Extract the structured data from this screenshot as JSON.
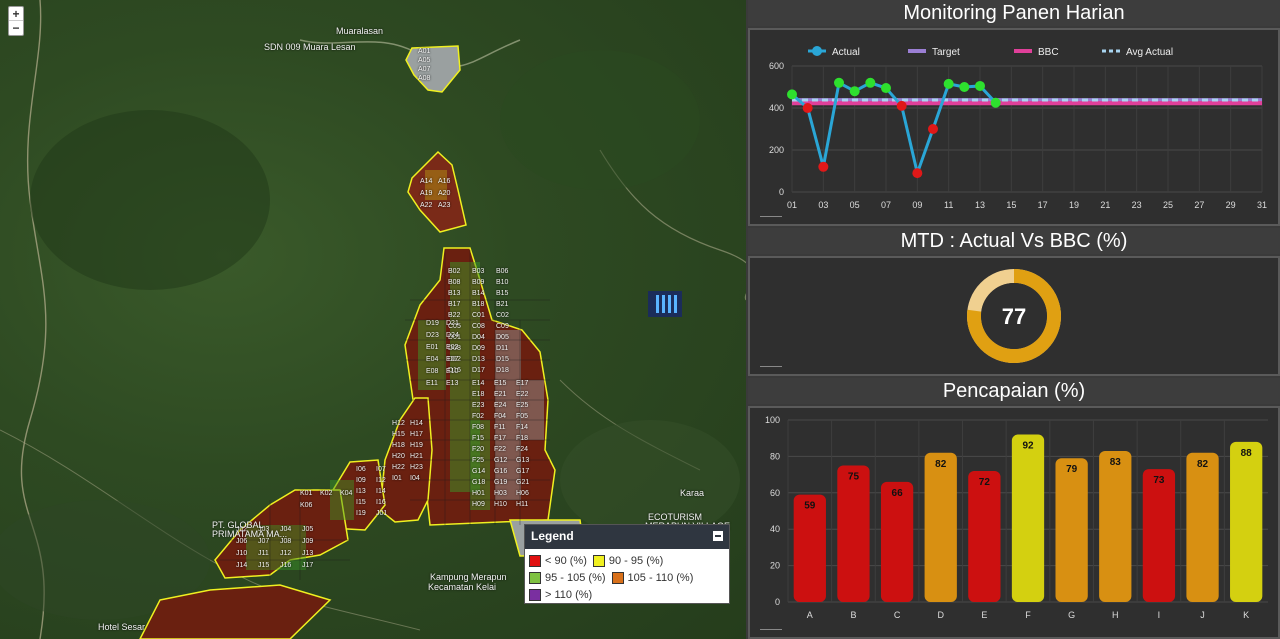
{
  "map": {
    "zoom_in": "+",
    "zoom_out": "−",
    "places": {
      "muaralasan": "Muaralasan",
      "sdn": "SDN 009 Muara Lesan",
      "karaa": "Karaa",
      "ecotourism_1": "ECOTURISM",
      "ecotourism_2": "MERAPUN VILLAGE",
      "global_1": "PT. GLOBAL",
      "global_2": "PRIMATAMA MA...",
      "kampung_1": "Kampung Merapun",
      "kampung_2": "Kecamatan Kelai",
      "hotel": "Hotel Sesar"
    },
    "block_labels": [
      "A01",
      "A05",
      "A07",
      "A08",
      "A14",
      "A16",
      "A19",
      "A20",
      "A22",
      "A23",
      "B02",
      "B03",
      "B06",
      "B08",
      "B09",
      "B10",
      "B13",
      "B14",
      "B15",
      "B17",
      "B18",
      "B21",
      "B22",
      "C01",
      "C02",
      "C05",
      "C08",
      "C09",
      "D01",
      "D04",
      "D05",
      "D08",
      "D09",
      "D11",
      "D12",
      "D13",
      "D15",
      "D16",
      "D17",
      "D18",
      "D19",
      "D21",
      "D23",
      "D24",
      "E01",
      "E02",
      "E04",
      "E07",
      "E08",
      "E10",
      "E11",
      "E13",
      "E14",
      "E15",
      "E17",
      "E18",
      "E21",
      "E22",
      "E23",
      "E24",
      "E25",
      "F02",
      "F04",
      "F05",
      "F08",
      "F11",
      "F14",
      "F15",
      "F17",
      "F18",
      "F20",
      "F22",
      "F24",
      "F25",
      "G12",
      "G13",
      "G14",
      "G16",
      "G17",
      "G18",
      "G19",
      "G21",
      "H01",
      "H03",
      "H06",
      "H09",
      "H10",
      "H11",
      "H12",
      "H14",
      "H15",
      "H17",
      "H18",
      "H19",
      "H20",
      "H21",
      "H22",
      "H23",
      "I01",
      "I04",
      "I06",
      "I07",
      "I09",
      "I12",
      "I13",
      "I14",
      "I15",
      "I16",
      "I19",
      "J01",
      "J02",
      "J03",
      "J04",
      "J05",
      "J06",
      "J07",
      "J08",
      "J09",
      "J10",
      "J11",
      "J12",
      "J13",
      "J14",
      "J15",
      "J16",
      "J17",
      "K01",
      "K02",
      "K04",
      "K06"
    ],
    "legend": {
      "title": "Legend",
      "items": [
        {
          "label": "< 90 (%)",
          "color": "#e01010"
        },
        {
          "label": "90 - 95 (%)",
          "color": "#f0f020"
        },
        {
          "label": "95 - 105 (%)",
          "color": "#7fc241"
        },
        {
          "label": "105 - 110 (%)",
          "color": "#d8701a"
        },
        {
          "label": "> 110 (%)",
          "color": "#7a2fa0"
        }
      ]
    }
  },
  "panel1": {
    "title": "Monitoring Panen Harian",
    "chart_data": {
      "type": "line",
      "ylim": [
        0,
        600
      ],
      "yticks": [
        0,
        200,
        400,
        600
      ],
      "xlabels": [
        "01",
        "03",
        "05",
        "07",
        "09",
        "11",
        "13",
        "15",
        "17",
        "19",
        "21",
        "23",
        "25",
        "27",
        "29",
        "31"
      ],
      "days": [
        1,
        2,
        3,
        4,
        5,
        6,
        7,
        8,
        9,
        10,
        11,
        12,
        13,
        14,
        15,
        16,
        17,
        18,
        19,
        20,
        21,
        22,
        23,
        24,
        25,
        26,
        27,
        28,
        29,
        30,
        31
      ],
      "series": [
        {
          "name": "Actual",
          "color": "#2aa6d6",
          "values": [
            465,
            400,
            120,
            520,
            480,
            520,
            495,
            410,
            90,
            300,
            515,
            500,
            505,
            425
          ]
        },
        {
          "name": "Target",
          "color": "#9b7fd4",
          "values": [
            440,
            440,
            440,
            440,
            440,
            440,
            440,
            440,
            440,
            440,
            440,
            440,
            440,
            440,
            440,
            440,
            440,
            440,
            440,
            440,
            440,
            440,
            440,
            440,
            440,
            440,
            440,
            440,
            440,
            440,
            440
          ]
        },
        {
          "name": "BBC",
          "color": "#e0409a",
          "values": [
            425,
            425,
            425,
            425,
            425,
            425,
            425,
            425,
            425,
            425,
            425,
            425,
            425,
            425,
            425,
            425,
            425,
            425,
            425,
            425,
            425,
            425,
            425,
            425,
            425,
            425,
            425,
            425,
            425,
            425,
            425
          ]
        },
        {
          "name": "Avg Actual",
          "color": "#a8d4f0",
          "values": [
            438,
            438,
            438,
            438,
            438,
            438,
            438,
            438,
            438,
            438,
            438,
            438,
            438,
            438,
            438,
            438,
            438,
            438,
            438,
            438,
            438,
            438,
            438,
            438,
            438,
            438,
            438,
            438,
            438,
            438,
            438
          ]
        }
      ]
    }
  },
  "panel2": {
    "title": "MTD : Actual Vs BBC (%)",
    "chart_data": {
      "type": "pie",
      "value": 77,
      "label": "77",
      "fill_color": "#e0a012",
      "rest_color": "#f0d090"
    }
  },
  "panel3": {
    "title": "Pencapaian (%)",
    "chart_data": {
      "type": "bar",
      "ylim": [
        0,
        100
      ],
      "yticks": [
        0,
        20,
        40,
        60,
        80,
        100
      ],
      "categories": [
        "A",
        "B",
        "C",
        "D",
        "E",
        "F",
        "G",
        "H",
        "I",
        "J",
        "K"
      ],
      "values": [
        59,
        75,
        66,
        82,
        72,
        92,
        79,
        83,
        73,
        82,
        88
      ],
      "colors": [
        "#cc1010",
        "#cc1010",
        "#cc1010",
        "#d89012",
        "#cc1010",
        "#d4d010",
        "#d89012",
        "#d89012",
        "#cc1010",
        "#d89012",
        "#d4d010"
      ]
    }
  }
}
